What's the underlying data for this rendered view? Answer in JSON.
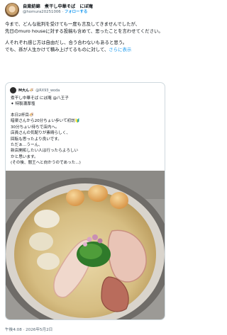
{
  "post": {
    "author": {
      "display_name": "自斎紡錦　煮干し中華そば　にぼ庵",
      "handle": "@homura20251006",
      "follow_label": "フォローする"
    },
    "separator": " · ",
    "body_paragraphs": [
      "今まで、どんな批判を受けても一度も言及してきませんでしたが、\n先日のmuro houseに対する投稿も含めて、思ったことを言わせてください。",
      "人それぞれ感じ方は自由だし、合う合わないもあると思う。\nでも、孫が人生かけて積み上げてるものに対して、"
    ],
    "more_label": "さらに表示",
    "timestamp": "午後4:08 · 2026年5月2日"
  },
  "quote": {
    "author_name": "M大ん🍜",
    "author_handle": "@RX93_woda",
    "shop_lines": "煮干し中華そば にぼ庵 @八王子\n✦ 特製濃厚塩",
    "body": "本日2杯目🍜\n暗渠さんから20分ちょい歩いて初訪🔰\n30分ちょい待ちで店内へ。\n店員さんの気配りが素晴らしく、\n回転も思ったより良いです。\nただぁ…うーん、\n新店開拓したい人は行ったらよろしい\nかと思います。\n(その後、闇王へと向かうのであった...)"
  },
  "colors": {
    "link": "#1d9bf0",
    "text_primary": "#0f1419",
    "text_secondary": "#536471",
    "border": "#cfd9de"
  }
}
